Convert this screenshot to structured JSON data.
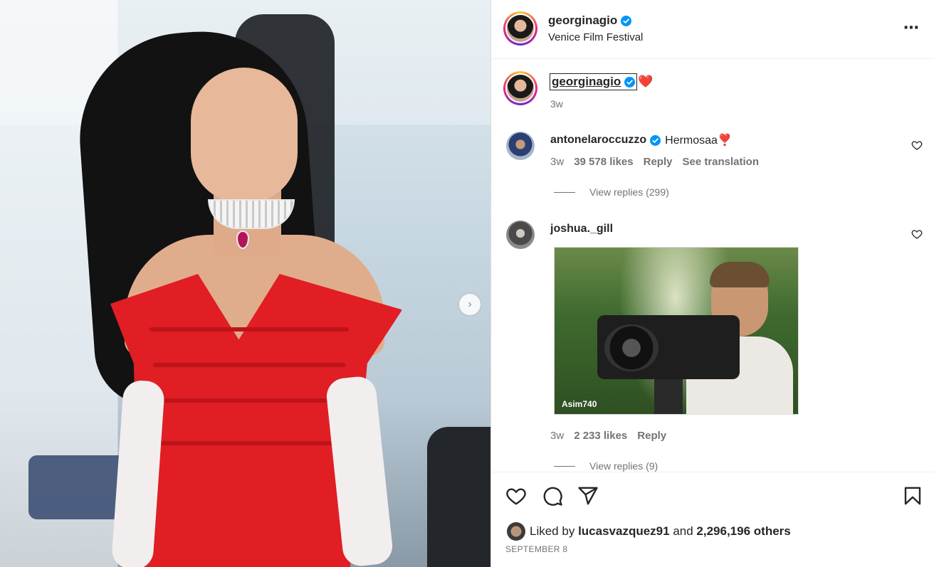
{
  "post": {
    "username": "georginagio",
    "location": "Venice Film Festival",
    "caption_username": "georginagio",
    "caption_emoji": "❤️",
    "caption_time": "3w"
  },
  "comments": [
    {
      "username": "antonelaroccuzzo",
      "verified": true,
      "text": "Hermosaa❣️",
      "time": "3w",
      "likes": "39 578 likes",
      "reply_label": "Reply",
      "translate_label": "See translation",
      "view_replies": "View replies (299)"
    },
    {
      "username": "joshua._gill",
      "verified": false,
      "text": "",
      "gif_watermark": "Asim740",
      "time": "3w",
      "likes": "2 233 likes",
      "reply_label": "Reply",
      "view_replies": "View replies (9)"
    }
  ],
  "footer": {
    "liked_by_prefix": "Liked by",
    "liked_by_user": "lucasvazquez91",
    "liked_by_and": "and",
    "liked_by_others": "2,296,196 others",
    "date": "SEPTEMBER 8"
  },
  "icons": {
    "more": "more-horizontal-icon",
    "next": "chevron-right-icon",
    "like": "heart-icon",
    "comment": "comment-icon",
    "share": "paper-plane-icon",
    "save": "bookmark-icon",
    "verified": "verified-badge-icon"
  },
  "colors": {
    "verified": "#0095f6",
    "heart": "#e0245e",
    "dress": "#e01e24",
    "text_primary": "#262626",
    "text_secondary": "#737373"
  }
}
